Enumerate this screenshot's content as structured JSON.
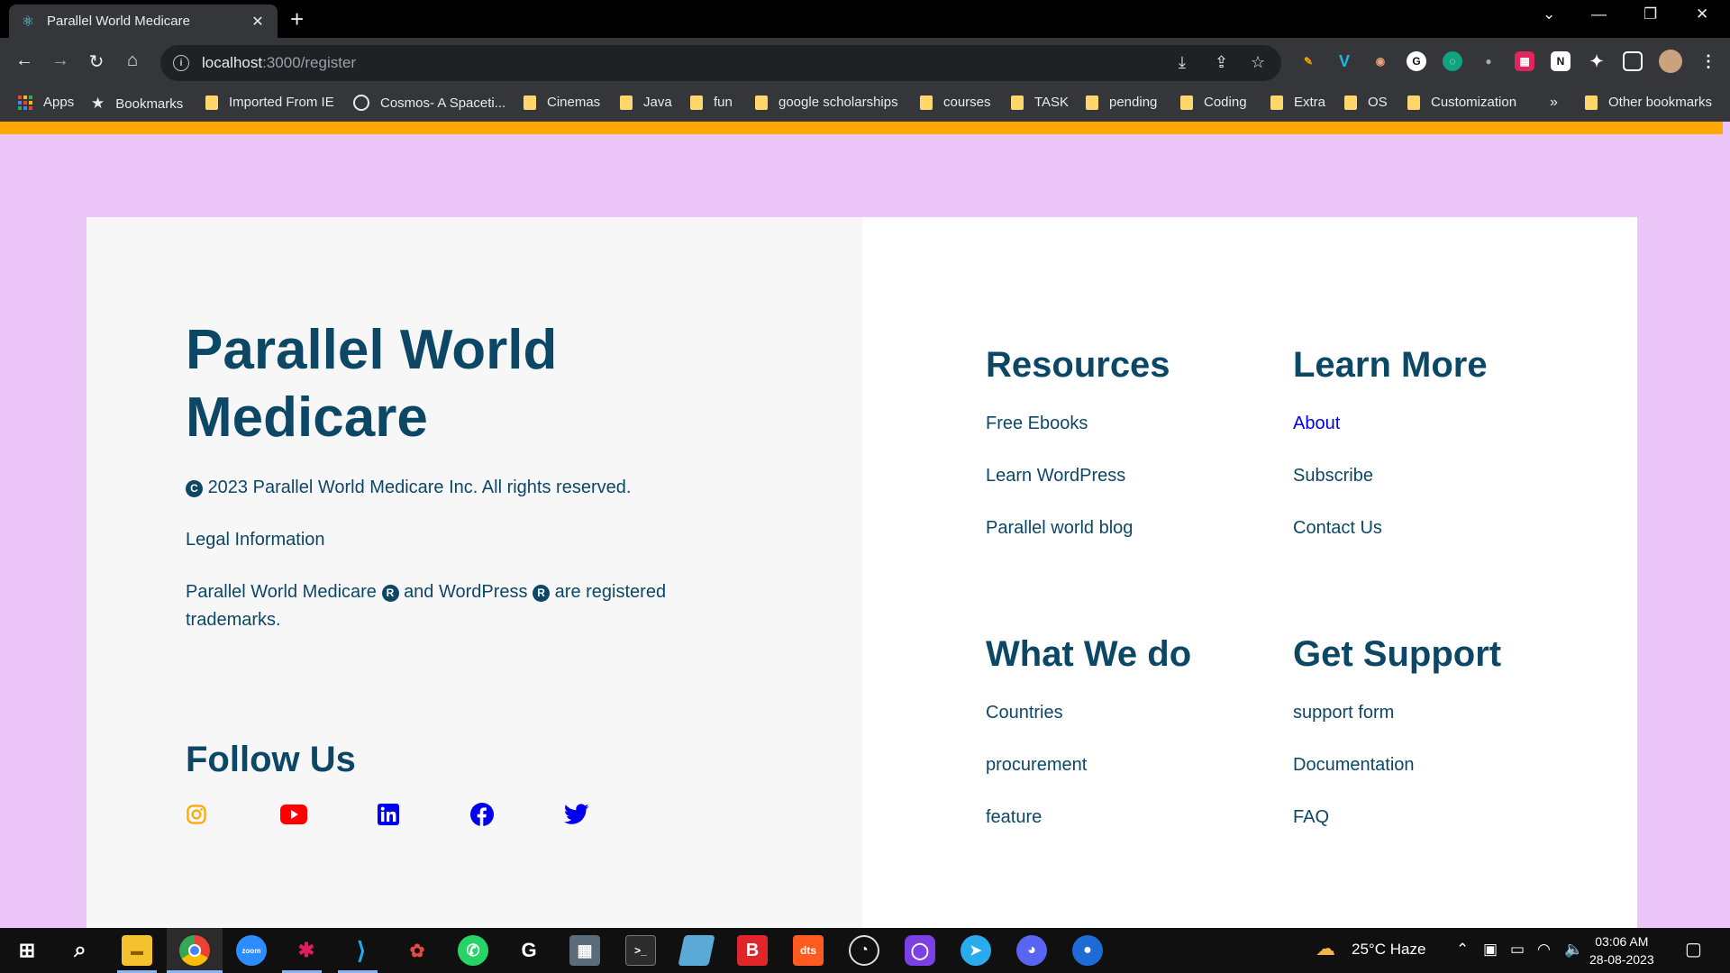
{
  "browser": {
    "tab_title": "Parallel World Medicare",
    "url_host": "localhost",
    "url_path": ":3000/register",
    "bookmarks": [
      {
        "label": "Apps",
        "kind": "apps"
      },
      {
        "label": "Bookmarks",
        "kind": "star"
      },
      {
        "label": "Imported From IE",
        "kind": "folder"
      },
      {
        "label": "Cosmos- A Spaceti...",
        "kind": "globe"
      },
      {
        "label": "Cinemas",
        "kind": "folder"
      },
      {
        "label": "Java",
        "kind": "folder"
      },
      {
        "label": "fun",
        "kind": "folder"
      },
      {
        "label": "google scholarships",
        "kind": "folder"
      },
      {
        "label": "courses",
        "kind": "folder"
      },
      {
        "label": "TASK",
        "kind": "folder"
      },
      {
        "label": "pending",
        "kind": "folder"
      },
      {
        "label": "Coding",
        "kind": "folder"
      },
      {
        "label": "Extra",
        "kind": "folder"
      },
      {
        "label": "OS",
        "kind": "folder"
      },
      {
        "label": "Customization",
        "kind": "folder"
      }
    ],
    "bookmarks_overflow": "»",
    "other_bookmarks": "Other bookmarks"
  },
  "footer": {
    "brand_title": "Parallel World Medicare",
    "copyright_symbol": "C",
    "copyright_text": "2023 Parallel World Medicare Inc. All rights reserved.",
    "legal": "Legal Information",
    "trademark_part1": "Parallel World Medicare",
    "registered_symbol": "R",
    "trademark_part2": "and WordPress",
    "trademark_part3": "are registered trademarks.",
    "follow_title": "Follow Us",
    "social": [
      {
        "name": "instagram-icon",
        "color": "#fda702"
      },
      {
        "name": "youtube-icon",
        "color": "#ff0000"
      },
      {
        "name": "linkedin-icon",
        "color": "#0000ee"
      },
      {
        "name": "facebook-icon",
        "color": "#0000ee"
      },
      {
        "name": "twitter-icon",
        "color": "#0000ee"
      }
    ],
    "columns": {
      "resources": {
        "title": "Resources",
        "links": [
          "Free Ebooks",
          "Learn WordPress",
          "Parallel world blog"
        ]
      },
      "learn_more": {
        "title": "Learn More",
        "links": [
          "About",
          "Subscribe",
          "Contact Us"
        ]
      },
      "what_we_do": {
        "title": "What We do",
        "links": [
          "Countries",
          "procurement",
          "feature"
        ]
      },
      "get_support": {
        "title": "Get Support",
        "links": [
          "support form",
          "Documentation",
          "FAQ"
        ]
      }
    }
  },
  "taskbar": {
    "weather": "25°C  Haze",
    "time": "03:06 AM",
    "date": "28-08-2023"
  },
  "colors": {
    "page_bg": "#ecc6f8",
    "accent_orange": "#fda702",
    "brand_navy": "#0d4766",
    "link_blue": "#0000ee"
  }
}
